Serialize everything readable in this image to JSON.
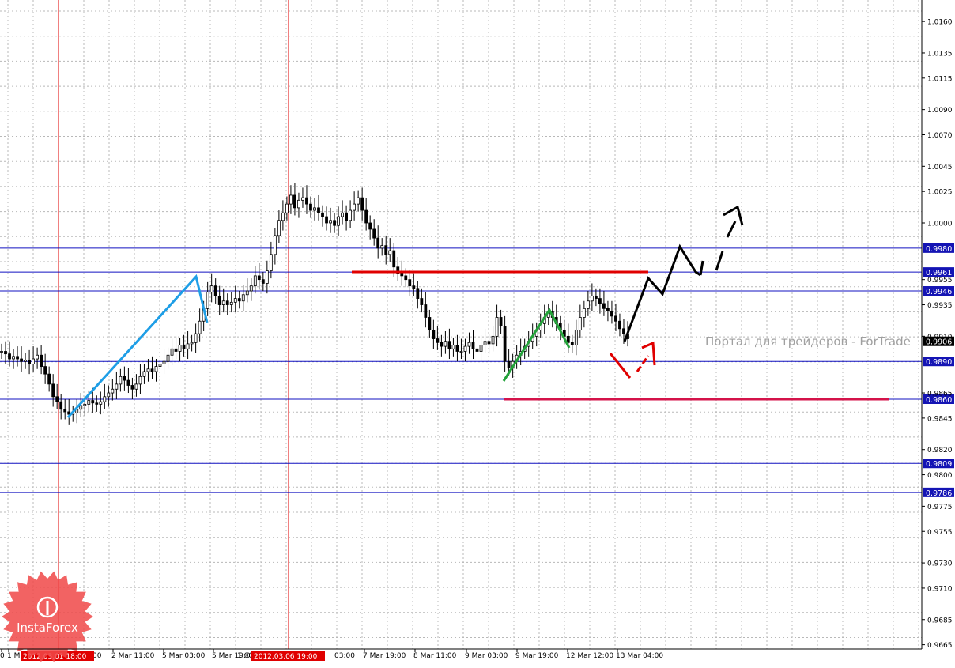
{
  "chart_data": {
    "type": "candlestick",
    "ylim": [
      0.9655,
      1.018
    ],
    "y_ticks": [
      "1.0160",
      "1.0135",
      "1.0115",
      "1.0090",
      "1.0070",
      "1.0045",
      "1.0025",
      "1.0000",
      "0.9955",
      "0.9935",
      "0.9910",
      "0.9865",
      "0.9845",
      "0.9820",
      "0.9800",
      "0.9775",
      "0.9755",
      "0.9730",
      "0.9710",
      "0.9685",
      "0.9665"
    ],
    "x_ticks": [
      "0",
      "1 M",
      "2 Mar 11:00",
      "5 Mar 03:00",
      "5 Mar 19:00",
      "7 Mar 19:00",
      "8 Mar 11:00",
      "9 Mar 03:00",
      "9 Mar 19:00",
      "12 Mar 12:00",
      "13 Mar 04:00"
    ],
    "x_tick_fragments": [
      "00",
      "1:00",
      "03:00"
    ],
    "highlighted_dates": [
      "2012.03.01 18:00",
      "2012.03.06 19:00"
    ],
    "horizontal_levels": [
      {
        "value": 0.998,
        "label": "0.9980"
      },
      {
        "value": 0.9961,
        "label": "0.9961"
      },
      {
        "value": 0.9946,
        "label": "0.9946"
      },
      {
        "value": 0.989,
        "label": "0.9890"
      },
      {
        "value": 0.986,
        "label": "0.9860"
      },
      {
        "value": 0.9809,
        "label": "0.9809"
      },
      {
        "value": 0.9786,
        "label": "0.9786"
      }
    ],
    "current_price": "0.9906",
    "candles_close_path": [
      [
        0.9898,
        0.9896,
        0.9892,
        0.9894,
        0.9892,
        0.989,
        0.9891,
        0.9888,
        0.9892,
        0.9895,
        0.9886,
        0.988,
        0.9872,
        0.9862,
        0.9858,
        0.9852,
        0.985,
        0.9848,
        0.9849,
        0.9852,
        0.9855,
        0.9856,
        0.9859,
        0.9857,
        0.9856,
        0.9858,
        0.9862,
        0.9865,
        0.9868,
        0.9872,
        0.9878,
        0.9875,
        0.9871,
        0.9868,
        0.9872,
        0.9878,
        0.9882,
        0.9884,
        0.9882,
        0.9886,
        0.9888,
        0.989,
        0.9895,
        0.99,
        0.9898,
        0.9903,
        0.99,
        0.9904,
        0.9905,
        0.9912,
        0.9922,
        0.9932,
        0.9945,
        0.995,
        0.9942,
        0.9935,
        0.9938,
        0.9935,
        0.9937,
        0.994,
        0.9938,
        0.9943,
        0.9946,
        0.995,
        0.9958,
        0.9955,
        0.9952,
        0.9962,
        0.9975,
        0.999,
        1.0002,
        1.0008,
        1.0015,
        1.0022,
        1.0012,
        1.0018,
        1.002,
        1.0015,
        1.001,
        1.0012,
        1.0008,
        1.0005,
        1.0,
        1.0002,
        0.9998,
        1.0005,
        1.0008,
        1.0002,
        1.001,
        1.0015,
        1.002,
        1.001,
        1.0,
        0.9995,
        0.9988,
        0.998,
        0.9982,
        0.9975,
        0.9978,
        0.9965,
        0.996,
        0.9958,
        0.9955,
        0.995,
        0.9948,
        0.994,
        0.9935,
        0.9925,
        0.9915,
        0.9908,
        0.9905,
        0.9902,
        0.9906,
        0.99,
        0.9903,
        0.9898,
        0.9898,
        0.9902,
        0.9905,
        0.99,
        0.9898,
        0.9903,
        0.9906,
        0.9904,
        0.991,
        0.9925,
        0.9918,
        0.989,
        0.9885,
        0.989,
        0.9895,
        0.9898,
        0.9902,
        0.9906,
        0.991,
        0.9915,
        0.992,
        0.9925,
        0.993,
        0.9925,
        0.992,
        0.9915,
        0.991,
        0.9905,
        0.9903,
        0.9915,
        0.9925,
        0.9932,
        0.9938,
        0.9942,
        0.994,
        0.9936,
        0.9932,
        0.993,
        0.9926,
        0.9922,
        0.9916,
        0.9912,
        0.9908
      ]
    ],
    "annotations": {
      "watermark_text": "Портал для трейдеров - ForTrade",
      "logo_text": "InstaForex"
    }
  }
}
